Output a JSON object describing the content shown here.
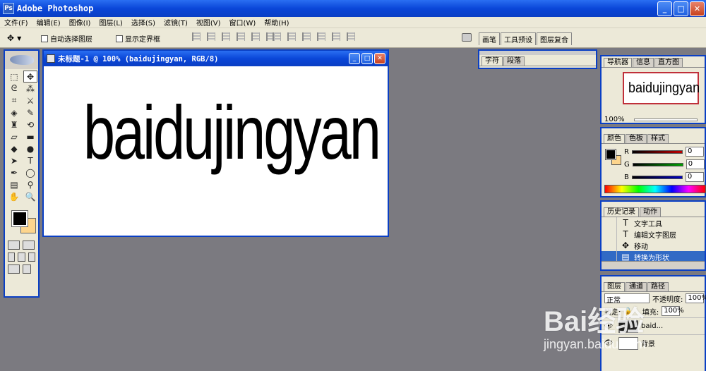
{
  "app": {
    "title": "Adobe Photoshop",
    "icon_name": "photoshop-icon"
  },
  "menu": [
    "文件(F)",
    "编辑(E)",
    "图像(I)",
    "图层(L)",
    "选择(S)",
    "滤镜(T)",
    "视图(V)",
    "窗口(W)",
    "帮助(H)"
  ],
  "options": {
    "auto_select": "自动选择图层",
    "show_bounds": "显示定界框"
  },
  "well_tabs": [
    "画笔",
    "工具预设",
    "图层复合"
  ],
  "document": {
    "title": "未标题-1 @ 100% (baidujingyan, RGB/8)",
    "canvas_text": "baidujingyan"
  },
  "char_panel": {
    "tabs": [
      "字符",
      "段落"
    ]
  },
  "navigator": {
    "tabs": [
      "导航器",
      "信息",
      "直方图"
    ],
    "thumb_text": "baidujingyan",
    "zoom": "100%"
  },
  "color_panel": {
    "tabs": [
      "颜色",
      "色板",
      "样式"
    ],
    "channels": [
      {
        "label": "R",
        "value": "0",
        "color": "#c00000"
      },
      {
        "label": "G",
        "value": "0",
        "color": "#00a000"
      },
      {
        "label": "B",
        "value": "0",
        "color": "#0000c0"
      }
    ]
  },
  "history": {
    "tabs": [
      "历史记录",
      "动作"
    ],
    "items": [
      "文字工具",
      "编辑文字图层",
      "移动",
      "转换为形状"
    ]
  },
  "layers": {
    "tabs": [
      "图层",
      "通道",
      "路径"
    ],
    "blend_mode": "正常",
    "opacity_label": "不透明度:",
    "opacity": "100%",
    "lock_label": "锁定:",
    "fill_label": "填充:",
    "fill": "100%",
    "items": [
      "baid...",
      "背景"
    ]
  },
  "watermark": {
    "main": "Bai经验",
    "sub": "jingyan.baidu.com"
  }
}
